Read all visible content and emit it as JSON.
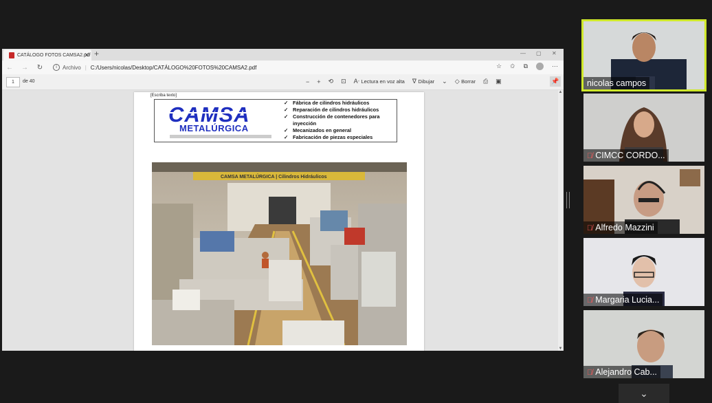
{
  "browser": {
    "tab_title": "CATÁLOGO FOTOS CAMSA2.pdf",
    "url_scheme": "Archivo",
    "url": "C:/Users/nicolas/Desktop/CATÁLOGO%20FOTOS%20CAMSA2.pdf"
  },
  "pdf_toolbar": {
    "page_current": "1",
    "page_total": "de 40",
    "read_aloud": "Lectura en voz alta",
    "draw": "Dibujar",
    "erase": "Borrar"
  },
  "document": {
    "placeholder": "[Escriba texto]",
    "logo_main": "CAMSA",
    "logo_sub": "METALÚRGICA",
    "services": [
      "Fábrica de cilindros hidráulicos",
      "Reparación de cilindros hidráulicos",
      "Construcción de contenedores para inyección",
      "Mecanizados en general",
      "Fabricación de piezas especiales"
    ],
    "photo_sign": "CAMSA METALÚRGICA | Cilindros Hidráulicos"
  },
  "participants": [
    {
      "name": "nicolas campos",
      "muted": false,
      "active": true
    },
    {
      "name": "CIMCC CORDO...",
      "muted": true,
      "active": false
    },
    {
      "name": "Alfredo Mazzini",
      "muted": true,
      "active": false
    },
    {
      "name": "Margaria Lucia...",
      "muted": true,
      "active": false
    },
    {
      "name": "Alejandro Cab...",
      "muted": true,
      "active": false
    }
  ],
  "colors": {
    "accent_speaker": "#cfe82a",
    "logo_blue": "#1f2fbf",
    "muted_red": "#ff5a5a"
  }
}
